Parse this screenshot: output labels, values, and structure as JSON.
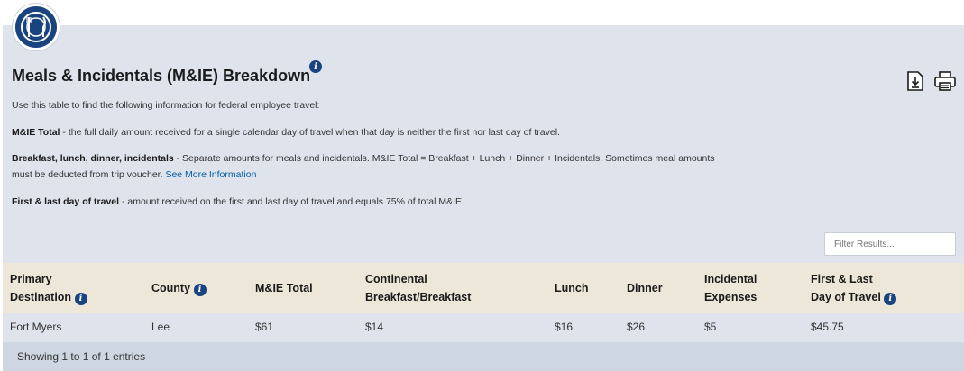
{
  "header": {
    "logo": "fork-knife-plate-icon",
    "title": "Meals & Incidentals (M&IE) Breakdown",
    "info_icon": "info-icon",
    "download_icon": "download-icon",
    "print_icon": "print-icon"
  },
  "description": {
    "intro": "Use this table to find the following information for federal employee travel:",
    "mie_total_label": "M&IE Total",
    "mie_total_text": " - the full daily amount received for a single calendar day of travel when that day is neither the first nor last day of travel.",
    "meals_label": "Breakfast, lunch, dinner, incidentals",
    "meals_text_1": " - Separate amounts for meals and incidentals. M&IE Total = Breakfast + Lunch + Dinner + Incidentals. Sometimes meal amounts",
    "meals_text_2": "must be deducted from trip voucher.",
    "see_more_link": "See More Information",
    "first_last_label": "First & last day of travel",
    "first_last_text": " - amount received on the first and last day of travel and equals 75% of total M&IE."
  },
  "filter": {
    "placeholder": "Filter Results..."
  },
  "table": {
    "headers": {
      "primary_destination": [
        "Primary",
        "Destination"
      ],
      "county": "County",
      "mie_total": "M&IE Total",
      "continental_breakfast": [
        "Continental",
        "Breakfast/Breakfast"
      ],
      "lunch": "Lunch",
      "dinner": "Dinner",
      "incidental_expenses": [
        "Incidental",
        "Expenses"
      ],
      "first_last_day": [
        "First & Last",
        "Day of Travel"
      ]
    },
    "rows": [
      {
        "primary_destination": "Fort Myers",
        "county": "Lee",
        "mie_total": "$61",
        "continental_breakfast": "$14",
        "lunch": "$16",
        "dinner": "$26",
        "incidental_expenses": "$5",
        "first_last_day": "$45.75"
      }
    ]
  },
  "footer": {
    "entries_text": "Showing 1 to 1 of 1 entries"
  }
}
